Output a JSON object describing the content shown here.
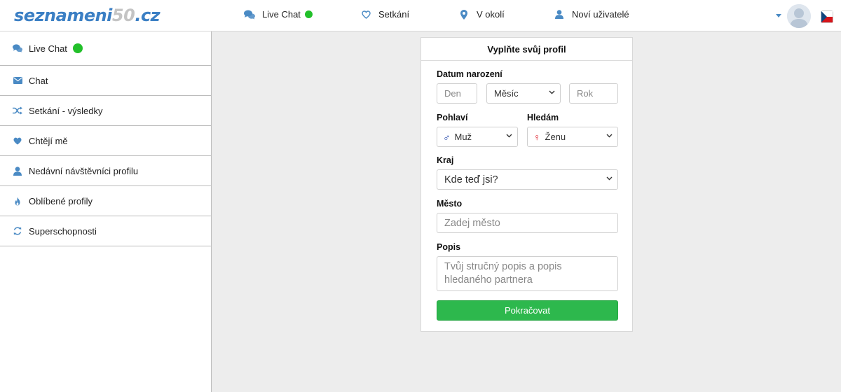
{
  "brand": {
    "part1": "seznameni",
    "part2": "50",
    "part3": ".cz"
  },
  "nav": [
    {
      "label": "Live Chat",
      "icon": "chat-bubbles-icon",
      "online": true
    },
    {
      "label": "Setkání",
      "icon": "heart-icon"
    },
    {
      "label": "V okolí",
      "icon": "map-marker-icon"
    },
    {
      "label": "Noví uživatelé",
      "icon": "user-icon"
    }
  ],
  "sidebar": {
    "items": [
      {
        "label": "Live Chat",
        "icon": "chat-bubbles-icon",
        "online": true
      },
      {
        "label": "Chat",
        "icon": "envelope-icon"
      },
      {
        "label": "Setkání - výsledky",
        "icon": "shuffle-icon"
      },
      {
        "label": "Chtějí mě",
        "icon": "heart-icon"
      },
      {
        "label": "Nedávní návštěvníci profilu",
        "icon": "user-icon"
      },
      {
        "label": "Oblíbené profily",
        "icon": "fire-icon"
      },
      {
        "label": "Superschopnosti",
        "icon": "refresh-icon"
      }
    ]
  },
  "form": {
    "title": "Vyplňte svůj profil",
    "birth_label": "Datum narození",
    "day_placeholder": "Den",
    "month_value": "Měsíc",
    "year_placeholder": "Rok",
    "gender_label": "Pohlaví",
    "gender_symbol": "♂",
    "gender_value": "Muž",
    "seeking_label": "Hledám",
    "seeking_symbol": "♀",
    "seeking_value": "Ženu",
    "region_label": "Kraj",
    "region_value": "Kde teď jsi?",
    "city_label": "Město",
    "city_placeholder": "Zadej město",
    "description_label": "Popis",
    "description_placeholder": "Tvůj stručný popis a popis hledaného partnera",
    "submit_label": "Pokračovat"
  },
  "colors": {
    "accent": "#4a8ac4",
    "online": "#22c02a",
    "button": "#2db84d",
    "male": "#1a3fa8",
    "female": "#e0242f"
  }
}
